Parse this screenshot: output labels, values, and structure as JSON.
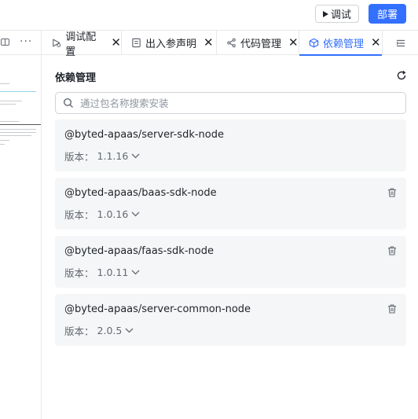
{
  "topbar": {
    "debug_label": "调试",
    "deploy_label": "部署"
  },
  "tabs": [
    {
      "label": "调试配置",
      "icon": "debug-config-icon",
      "active": false
    },
    {
      "label": "出入参声明",
      "icon": "doc-icon",
      "active": false
    },
    {
      "label": "代码管理",
      "icon": "branch-icon",
      "active": false
    },
    {
      "label": "依赖管理",
      "icon": "package-icon",
      "active": true
    }
  ],
  "panel": {
    "title": "依赖管理",
    "search_placeholder": "通过包名称搜索安装"
  },
  "version_prefix": "版本：",
  "dependencies": [
    {
      "name": "@byted-apaas/server-sdk-node",
      "version": "1.1.16",
      "deletable": false
    },
    {
      "name": "@byted-apaas/baas-sdk-node",
      "version": "1.0.16",
      "deletable": true
    },
    {
      "name": "@byted-apaas/faas-sdk-node",
      "version": "1.0.11",
      "deletable": true
    },
    {
      "name": "@byted-apaas/server-common-node",
      "version": "2.0.5",
      "deletable": true
    }
  ],
  "colors": {
    "accent": "#3370ff",
    "card_bg": "#f5f6f7",
    "border": "#e6e8ea"
  }
}
